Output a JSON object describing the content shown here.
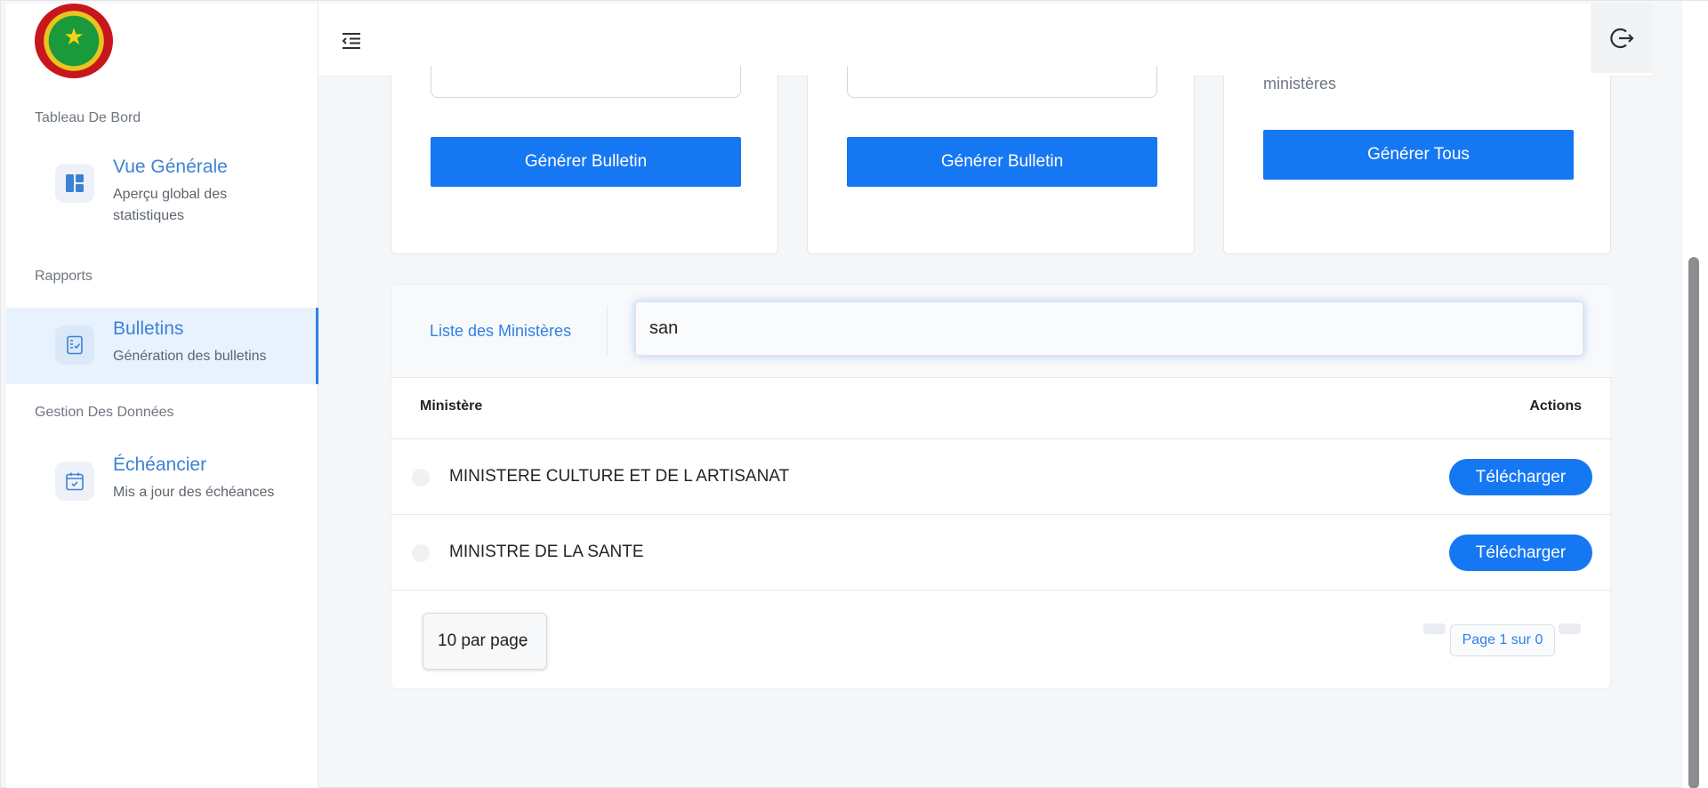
{
  "sidebar": {
    "sections": [
      {
        "label": "Tableau De Bord"
      },
      {
        "label": "Rapports"
      },
      {
        "label": "Gestion Des Données"
      }
    ],
    "items": [
      {
        "title": "Vue Générale",
        "subtitle": "Aperçu global des statistiques",
        "icon": "dashboard-icon",
        "active": false
      },
      {
        "title": "Bulletins",
        "subtitle": "Génération des bulletins",
        "icon": "document-check-icon",
        "active": true
      },
      {
        "title": "Échéancier",
        "subtitle": "Mis a jour des échéances",
        "icon": "calendar-check-icon",
        "active": false
      }
    ]
  },
  "topbar": {
    "menu_icon": "menu-indent-icon",
    "logout_icon": "logout-icon"
  },
  "cards": [
    {
      "button_label": "Générer Bulletin"
    },
    {
      "button_label": "Générer Bulletin"
    },
    {
      "description": "ministères",
      "button_label": "Générer Tous"
    }
  ],
  "list": {
    "title": "Liste des Ministères",
    "search_value": "san",
    "columns": {
      "ministere": "Ministère",
      "actions": "Actions"
    },
    "rows": [
      {
        "name": "MINISTERE CULTURE ET DE L ARTISANAT",
        "action_label": "Télécharger"
      },
      {
        "name": "MINISTRE DE LA SANTE",
        "action_label": "Télécharger"
      }
    ],
    "page_size": "10 par page",
    "page_info": "Page 1 sur 0"
  },
  "colors": {
    "accent": "#1677f3",
    "link": "#2f7fe8",
    "active_bg": "#e8f2fe"
  }
}
